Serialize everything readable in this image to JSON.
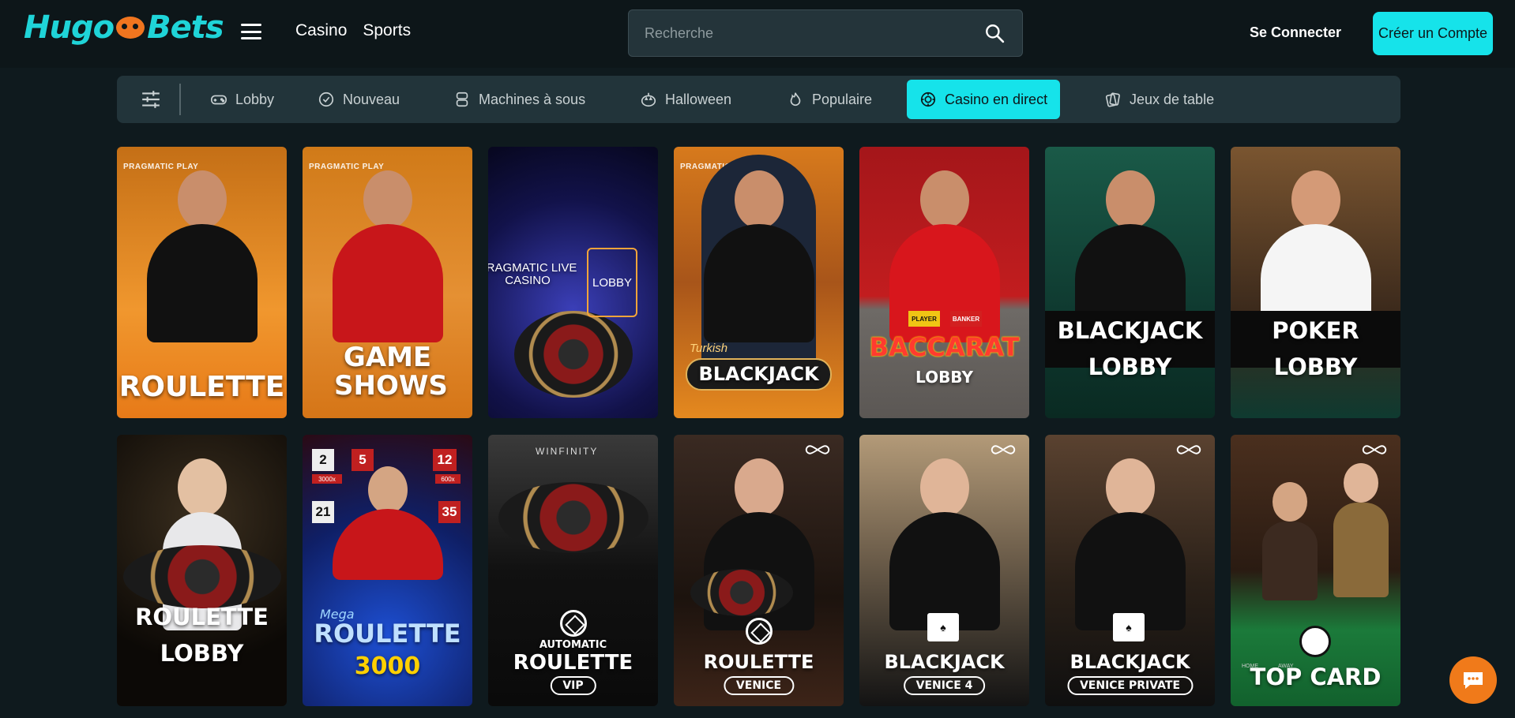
{
  "header": {
    "logo": {
      "part1": "Hugo",
      "part2": "Bets"
    },
    "nav": [
      "Casino",
      "Sports"
    ],
    "search_placeholder": "Recherche",
    "login_label": "Se Connecter",
    "signup_label": "Créer un Compte"
  },
  "categories": [
    {
      "label": "Lobby",
      "icon": "gamepad-icon",
      "active": false
    },
    {
      "label": "Nouveau",
      "icon": "badge-check-icon",
      "active": false
    },
    {
      "label": "Machines à sous",
      "icon": "slot-machine-icon",
      "active": false
    },
    {
      "label": "Halloween",
      "icon": "pumpkin-icon",
      "active": false
    },
    {
      "label": "Populaire",
      "icon": "flame-icon",
      "active": false
    },
    {
      "label": "Casino en direct",
      "icon": "roulette-chip-icon",
      "active": true
    },
    {
      "label": "Jeux de table",
      "icon": "cards-icon",
      "active": false
    }
  ],
  "games_row1": [
    {
      "title": "ROULETTE",
      "provider": "PRAGMATIC PLAY"
    },
    {
      "title": "GAME SHOWS",
      "provider": "PRAGMATIC PLAY"
    },
    {
      "title": "PRAGMATIC LIVE CASINO",
      "badge": "LOBBY"
    },
    {
      "title": "BLACKJACK",
      "provider": "PRAGMATIC PLAY",
      "prefix": "Turkish"
    },
    {
      "title": "BACCARAT",
      "sub": "LOBBY",
      "chips": [
        "PLAYER",
        "BANKER"
      ]
    },
    {
      "title": "BLACKJACK",
      "sub": "LOBBY"
    },
    {
      "title": "POKER",
      "sub": "LOBBY"
    }
  ],
  "games_row2": [
    {
      "title": "ROULETTE",
      "sub": "LOBBY"
    },
    {
      "prefix": "Mega",
      "title": "ROULETTE",
      "number": "3000",
      "multipliers": [
        "2",
        "5",
        "12",
        "21",
        "35"
      ],
      "mult_badges": [
        "3000x",
        "600x"
      ]
    },
    {
      "brand": "WINFINITY",
      "top": "AUTOMATIC",
      "title": "ROULETTE",
      "tag": "VIP"
    },
    {
      "title": "ROULETTE",
      "tag": "VENICE"
    },
    {
      "title": "BLACKJACK",
      "tag": "VENICE 4"
    },
    {
      "title": "BLACKJACK",
      "tag": "VENICE PRIVATE"
    },
    {
      "top_labels": [
        "HOME",
        "AWAY"
      ],
      "title": "TOP CARD"
    }
  ],
  "colors": {
    "accent": "#16e3ea",
    "background": "#0f1a1e",
    "chat": "#f07a1a"
  }
}
